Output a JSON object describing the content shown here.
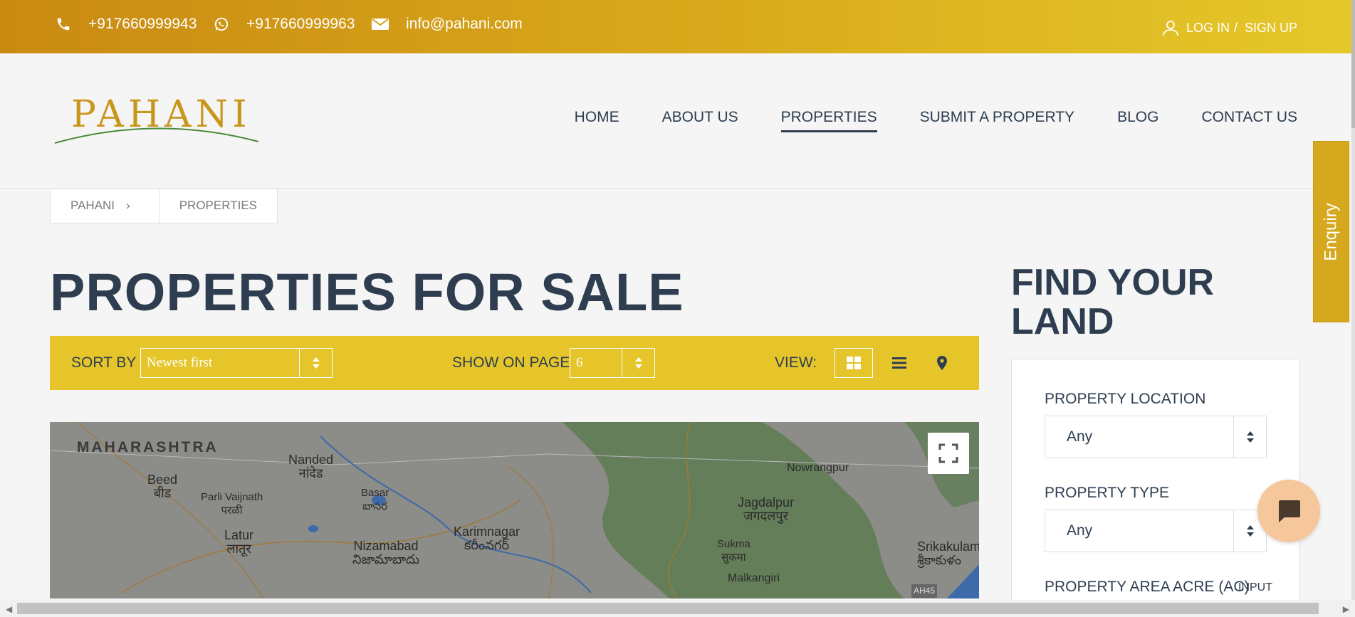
{
  "topbar": {
    "phone": "+917660999943",
    "whatsapp": "+917660999963",
    "email": "info@pahani.com",
    "login": "LOG IN",
    "separator": "/",
    "signup": "SIGN UP"
  },
  "brand": {
    "logo_text": "PAHANI"
  },
  "nav": {
    "home": "HOME",
    "about": "ABOUT US",
    "properties": "PROPERTIES",
    "submit": "SUBMIT A PROPERTY",
    "blog": "BLOG",
    "contact": "CONTACT US"
  },
  "breadcrumb": {
    "root": "PAHANI",
    "current": "PROPERTIES"
  },
  "page": {
    "title": "PROPERTIES FOR SALE"
  },
  "filters": {
    "sort_label": "SORT BY",
    "sort_value": "Newest first",
    "show_label": "SHOW ON PAGE",
    "show_value": "6",
    "view_label": "VIEW:"
  },
  "map": {
    "labels": {
      "maharashtra": "MAHARASHTRA",
      "nanded": "Nanded",
      "nanded_local": "नांदेड",
      "beed": "Beed",
      "beed_local": "बीड",
      "parli": "Parli Vaijnath",
      "parli_local": "परळी",
      "basar": "Basar",
      "basar_local": "బాసర",
      "latur": "Latur",
      "latur_local": "लातूर",
      "nizamabad": "Nizamabad",
      "nizamabad_local": "నిజామాబాదు",
      "karimnagar": "Karimnagar",
      "karimnagar_local": "కరీంనగర్",
      "nowrangpur": "Nowrangpur",
      "jagdalpur": "Jagdalpur",
      "jagdalpur_local": "जगदलपुर",
      "sukma": "Sukma",
      "sukma_local": "सुकमा",
      "malkangiri": "Malkangiri",
      "srikakulam": "Srikakulam",
      "srikakulam_local": "శ్రీకాకుళం",
      "ah45": "AH45"
    }
  },
  "sidebar": {
    "title": "FIND YOUR LAND",
    "location_label": "PROPERTY LOCATION",
    "location_value": "Any",
    "type_label": "PROPERTY TYPE",
    "type_value": "Any",
    "area_label": "PROPERTY AREA ACRE (AC)",
    "area_hint": "INPUT"
  },
  "enquiry": {
    "label": "Enquiry"
  },
  "colors": {
    "accent": "#e5c52a",
    "topbar_start": "#c98a12",
    "navy": "#2e3e50"
  }
}
